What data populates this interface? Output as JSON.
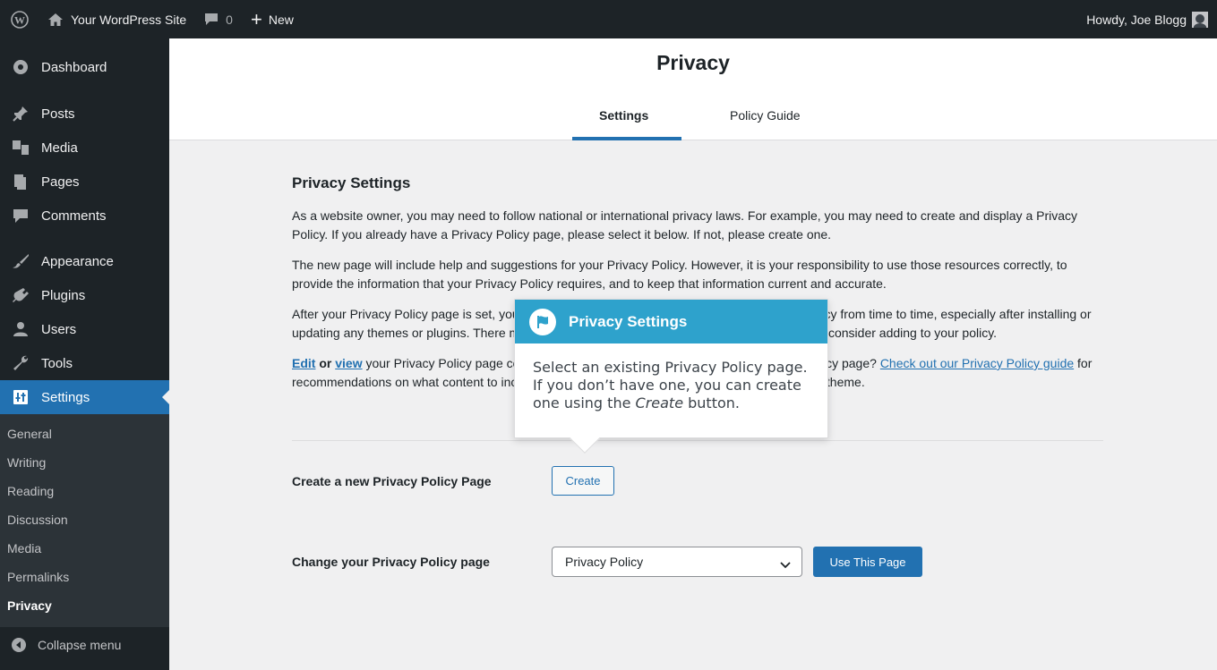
{
  "adminbar": {
    "site_name": "Your WordPress Site",
    "comment_count": "0",
    "new_label": "New",
    "howdy": "Howdy, Joe Blogg"
  },
  "sidebar": {
    "items": [
      {
        "label": "Dashboard",
        "icon": "dashboard-icon"
      },
      {
        "label": "Posts",
        "icon": "pin-icon"
      },
      {
        "label": "Media",
        "icon": "media-icon"
      },
      {
        "label": "Pages",
        "icon": "pages-icon"
      },
      {
        "label": "Comments",
        "icon": "comment-icon"
      },
      {
        "label": "Appearance",
        "icon": "brush-icon"
      },
      {
        "label": "Plugins",
        "icon": "plug-icon"
      },
      {
        "label": "Users",
        "icon": "user-icon"
      },
      {
        "label": "Tools",
        "icon": "wrench-icon"
      },
      {
        "label": "Settings",
        "icon": "settings-icon"
      }
    ],
    "submenu": [
      "General",
      "Writing",
      "Reading",
      "Discussion",
      "Media",
      "Permalinks",
      "Privacy"
    ],
    "collapse_label": "Collapse menu"
  },
  "header": {
    "title": "Privacy",
    "tabs": [
      {
        "label": "Settings"
      },
      {
        "label": "Policy Guide"
      }
    ]
  },
  "content": {
    "heading": "Privacy Settings",
    "p1": "As a website owner, you may need to follow national or international privacy laws. For example, you may need to create and display a Privacy Policy. If you already have a Privacy Policy page, please select it below. If not, please create one.",
    "p2": "The new page will include help and suggestions for your Privacy Policy. However, it is your responsibility to use those resources correctly, to provide the information that your Privacy Policy requires, and to keep that information current and accurate.",
    "p3": "After your Privacy Policy page is set, you should edit it. You should also review your Privacy Policy from time to time, especially after installing or updating any themes or plugins. There may be changes or new suggested information for you to consider adding to your policy.",
    "p4_edit": "Edit",
    "p4_or": " or ",
    "p4_view": "view",
    "p4_mid": " your Privacy Policy page content. Need help putting together your new Privacy Policy page? ",
    "p4_link": "Check out our Privacy Policy guide",
    "p4_end": " for recommendations on what content to include, along with policies suggested by your plugins and theme.",
    "create_label": "Create a new Privacy Policy Page",
    "create_button": "Create",
    "change_label": "Change your Privacy Policy page",
    "select_value": "Privacy Policy",
    "use_button": "Use This Page"
  },
  "pointer": {
    "title": "Privacy Settings",
    "body_pre": "Select an existing Privacy Policy page. If you don’t have one, you can create one using the ",
    "body_em": "Create",
    "body_post": " button."
  }
}
